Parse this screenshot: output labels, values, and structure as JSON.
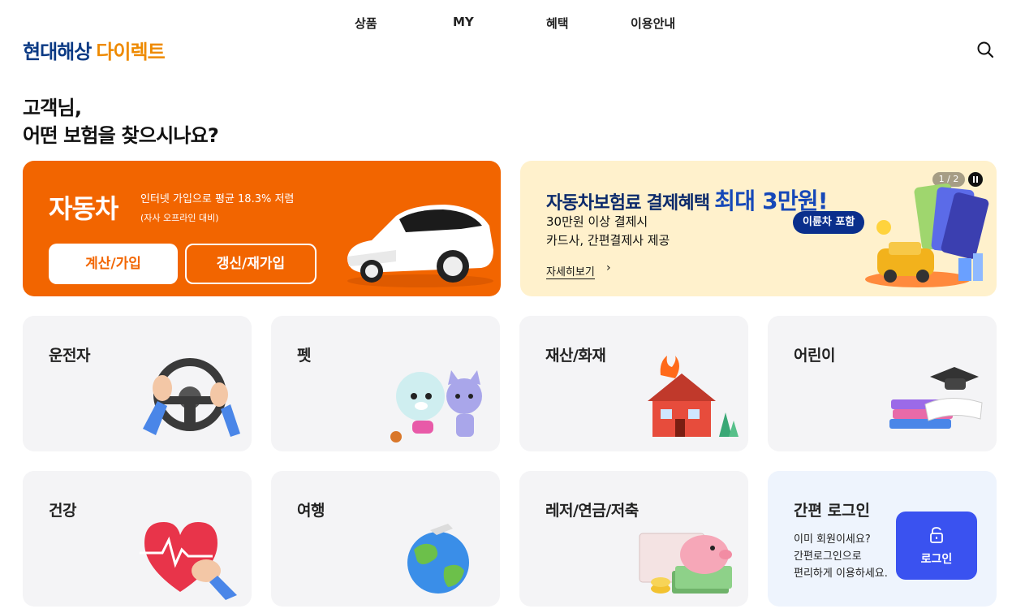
{
  "header": {
    "logo_main": "현대해상",
    "logo_sub": "다이렉트",
    "nav": [
      "상품",
      "MY",
      "혜택",
      "이용안내"
    ]
  },
  "greeting": {
    "line1": "고객님,",
    "line2": "어떤 보험을 찾으시나요?"
  },
  "car": {
    "title": "자동차",
    "desc": "인터넷 가입으로 평균 18.3% 저렴",
    "sub": "(자사 오프라인 대비)",
    "btn_calc": "계산/가입",
    "btn_renew": "갱신/재가입"
  },
  "promo": {
    "title": "자동차보험료 결제혜택",
    "highlight": "최대 3만원!",
    "line1": "30만원 이상 결제시",
    "line2": "카드사, 간편결제사 제공",
    "badge": "이륜차 포함",
    "more": "자세히보기",
    "pager": "1 / 2"
  },
  "tiles": [
    "운전자",
    "펫",
    "재산/화재",
    "어린이",
    "건강",
    "여행",
    "레저/연금/저축"
  ],
  "login": {
    "title": "간편 로그인",
    "desc1": "이미 회원이세요?",
    "desc2": "간편로그인으로",
    "desc3": "편리하게 이용하세요.",
    "btn": "로그인"
  },
  "colors": {
    "brand_navy": "#0b3a84",
    "brand_orange": "#ee8a00",
    "car_card": "#f26500",
    "promo_bg": "#fff1cc",
    "login_button": "#3a52f0"
  },
  "icons": [
    "search-icon",
    "chevron-right-icon",
    "pause-icon",
    "lock-icon"
  ]
}
